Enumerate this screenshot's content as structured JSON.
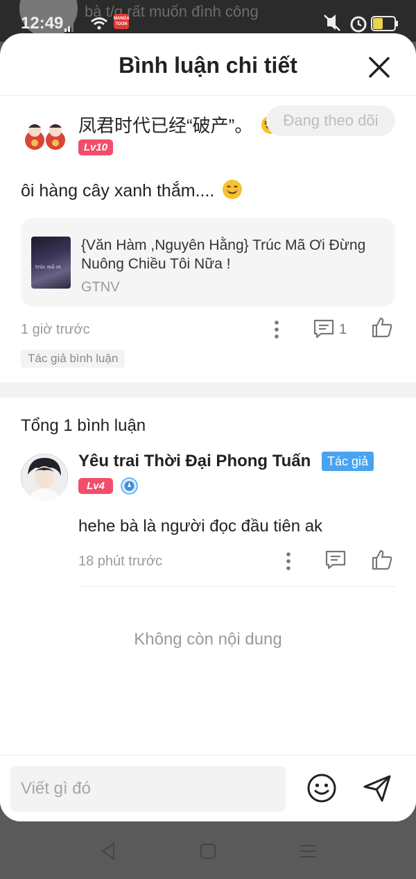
{
  "background": {
    "header_text": "bà t/g rất muốn đình công"
  },
  "status_bar": {
    "time": "12:49",
    "battery": "37",
    "app_badge": "MANGA TOON"
  },
  "header": {
    "title": "Bình luận chi tiết"
  },
  "original_comment": {
    "username": "凤君时代已经“破产”。",
    "level": "Lv10",
    "follow_label": "Đang theo dõi",
    "text": "ôi hàng cây xanh thắm....",
    "book": {
      "title": "{Văn Hàm ,Nguyên Hằng} Trúc Mã Ơi Đừng Nuông Chiều Tôi Nữa !",
      "subtitle": "GTNV",
      "cover_text": "trúc mã ơi"
    },
    "time": "1 giờ trước",
    "reply_count": "1",
    "tag": "Tác giả bình luận"
  },
  "replies": {
    "total_label": "Tổng 1 bình luận",
    "items": [
      {
        "username": "Yêu trai Thời Đại Phong Tuấn",
        "author_badge": "Tác giả",
        "level": "Lv4",
        "text": "hehe bà là người đọc đầu tiên ak",
        "time": "18 phút trước"
      }
    ],
    "empty_label": "Không còn nội dung"
  },
  "footer": {
    "input_placeholder": "Viết gì đó"
  },
  "colors": {
    "level_badge": "#f24e6a",
    "author_badge": "#4aa3f0",
    "sheet": "#ffffff",
    "muted_text": "#9a9a9a"
  },
  "icons": [
    "close-icon",
    "more-icon",
    "comment-icon",
    "like-icon",
    "emoji-icon",
    "send-icon",
    "back-icon",
    "home-icon",
    "menu-icon",
    "badge-icon",
    "wifi-icon",
    "signal-icon",
    "mute-icon",
    "alarm-icon",
    "battery-icon"
  ]
}
